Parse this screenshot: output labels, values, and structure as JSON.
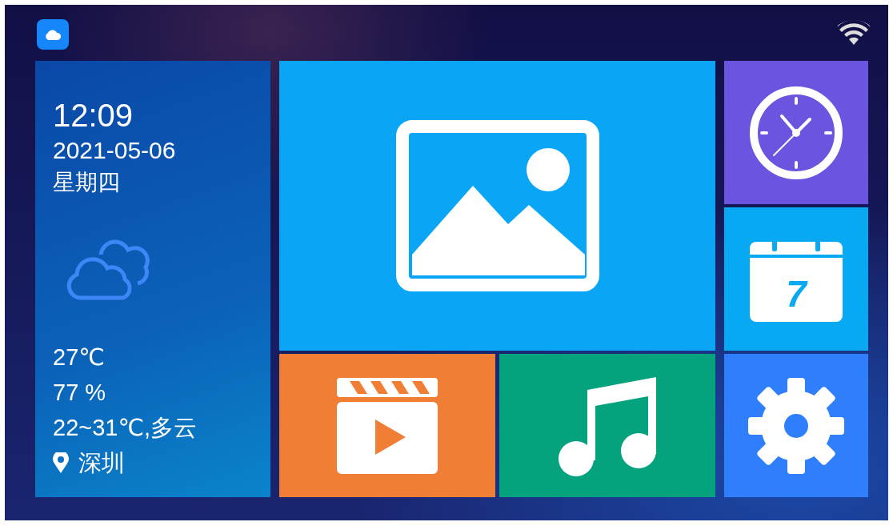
{
  "weather_panel": {
    "time": "12:09",
    "date": "2021-05-06",
    "weekday": "星期四",
    "temperature": "27℃",
    "humidity": "77 %",
    "forecast": "22~31℃,多云",
    "city": "深圳"
  },
  "tiles": [
    {
      "kind": "photos",
      "color": "#0aa6f5"
    },
    {
      "kind": "clock",
      "color": "#6a54e0"
    },
    {
      "kind": "calendar",
      "color": "#07a9f3",
      "day": "7"
    },
    {
      "kind": "video",
      "color": "#f07f35"
    },
    {
      "kind": "music",
      "color": "#04a37d"
    },
    {
      "kind": "settings",
      "color": "#2f7ffc"
    }
  ]
}
